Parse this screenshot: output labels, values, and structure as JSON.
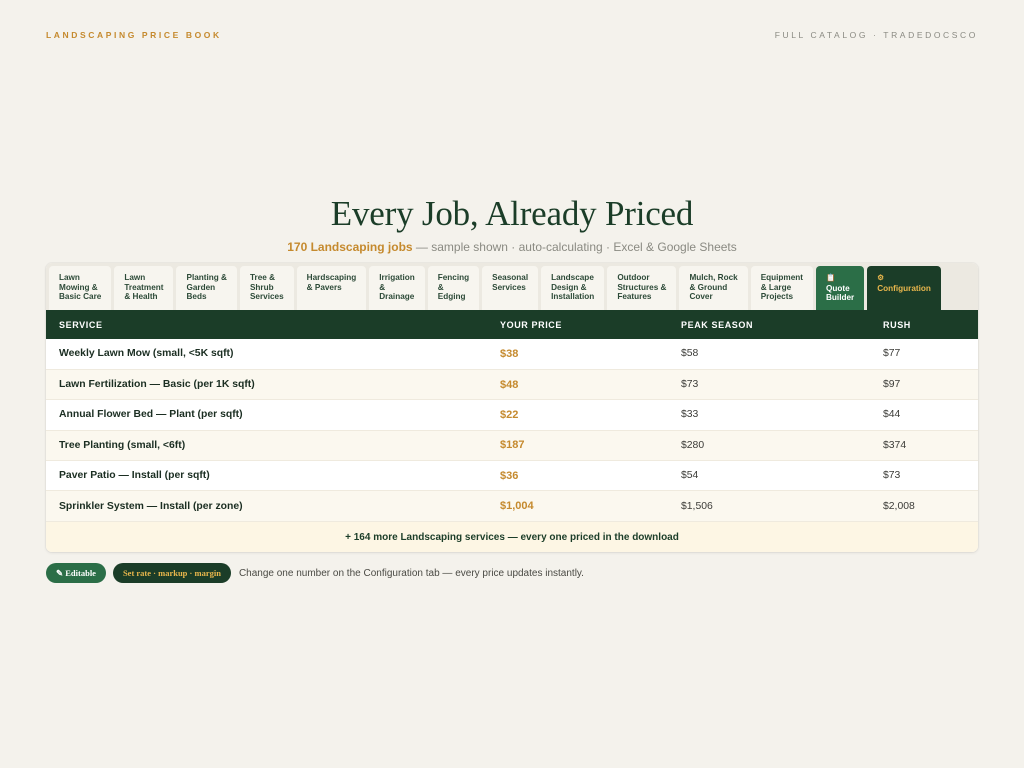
{
  "header": {
    "brand": "LANDSCAPING PRICE BOOK",
    "catalog": "FULL CATALOG · TRADEDOCSCO"
  },
  "hero": {
    "title": "Every Job, Already Priced",
    "count_text": "170 Landscaping jobs",
    "rest_text": " — sample shown · auto-calculating · Excel & Google Sheets"
  },
  "tabs": [
    {
      "line1": "Lawn",
      "line2": "Mowing &",
      "line3": "Basic Care"
    },
    {
      "line1": "Lawn",
      "line2": "Treatment",
      "line3": "& Health"
    },
    {
      "line1": "Planting &",
      "line2": "Garden",
      "line3": "Beds"
    },
    {
      "line1": "Tree &",
      "line2": "Shrub",
      "line3": "Services"
    },
    {
      "line1": "Hardscaping",
      "line2": "& Pavers",
      "line3": ""
    },
    {
      "line1": "Irrigation",
      "line2": "&",
      "line3": "Drainage"
    },
    {
      "line1": "Fencing",
      "line2": "&",
      "line3": "Edging"
    },
    {
      "line1": "Seasonal",
      "line2": "Services",
      "line3": ""
    },
    {
      "line1": "Landscape",
      "line2": "Design &",
      "line3": "Installation"
    },
    {
      "line1": "Outdoor",
      "line2": "Structures &",
      "line3": "Features"
    },
    {
      "line1": "Mulch, Rock",
      "line2": "& Ground",
      "line3": "Cover"
    },
    {
      "line1": "Equipment",
      "line2": "& Large",
      "line3": "Projects"
    },
    {
      "icon": "📋",
      "line1": "Quote",
      "line2": "Builder",
      "line3": ""
    },
    {
      "icon": "⚙",
      "line1": "Configuration",
      "line2": "",
      "line3": ""
    }
  ],
  "table": {
    "headers": [
      "SERVICE",
      "YOUR PRICE",
      "PEAK SEASON",
      "RUSH"
    ],
    "rows": [
      {
        "service": "Weekly Lawn Mow (small, <5K sqft)",
        "price": "$38",
        "peak": "$58",
        "rush": "$77"
      },
      {
        "service": "Lawn Fertilization — Basic (per 1K sqft)",
        "price": "$48",
        "peak": "$73",
        "rush": "$97"
      },
      {
        "service": "Annual Flower Bed — Plant (per sqft)",
        "price": "$22",
        "peak": "$33",
        "rush": "$44"
      },
      {
        "service": "Tree Planting (small, <6ft)",
        "price": "$187",
        "peak": "$280",
        "rush": "$374"
      },
      {
        "service": "Paver Patio — Install (per sqft)",
        "price": "$36",
        "peak": "$54",
        "rush": "$73"
      },
      {
        "service": "Sprinkler System — Install (per zone)",
        "price": "$1,004",
        "peak": "$1,506",
        "rush": "$2,008"
      }
    ],
    "more_text": "+ 164 more Landscaping services — every one priced in the download"
  },
  "footer": {
    "editable_label": "✎ Editable",
    "rate_label": "Set rate · markup · margin",
    "note": "Change one number on the Configuration tab — every price updates instantly."
  },
  "colors": {
    "accent_gold": "#c58a2e",
    "dark_green": "#1b3d28",
    "mid_green": "#2b6e47",
    "background": "#f4f2ec"
  }
}
